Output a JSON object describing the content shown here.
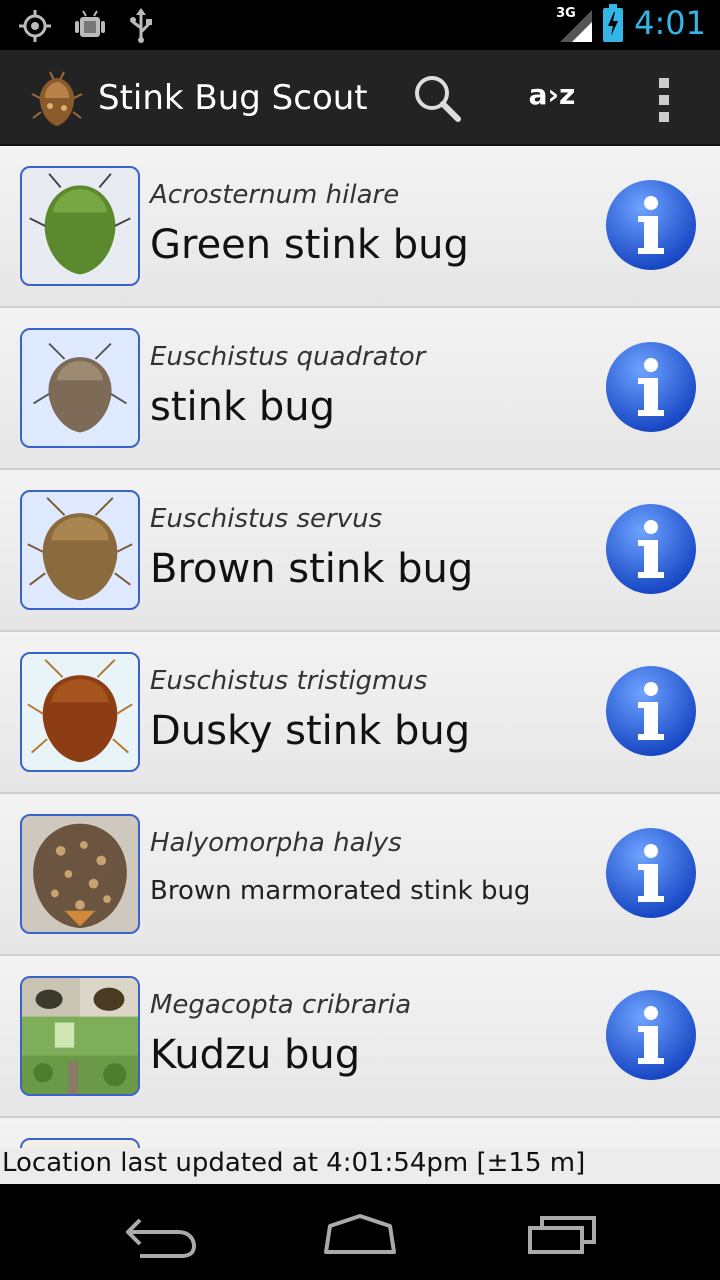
{
  "status": {
    "time": "4:01",
    "network": "3G"
  },
  "app": {
    "title": "Stink Bug Scout",
    "sort_label": "a›z"
  },
  "items": [
    {
      "scientific": "Acrosternum hilare",
      "common": "Green stink bug"
    },
    {
      "scientific": "Euschistus quadrator",
      "common": "stink bug"
    },
    {
      "scientific": "Euschistus servus",
      "common": "Brown stink bug"
    },
    {
      "scientific": "Euschistus tristigmus",
      "common": "Dusky stink bug"
    },
    {
      "scientific": "Halyomorpha halys",
      "common": "Brown marmorated stink bug"
    },
    {
      "scientific": "Megacopta cribraria",
      "common": "Kudzu bug"
    }
  ],
  "footer": {
    "location_text": "Location last updated at 4:01:54pm [±15 m]"
  },
  "colors": {
    "time": "#33b5e5",
    "action_bar": "#232323",
    "info_button": "#1f5fd6"
  }
}
